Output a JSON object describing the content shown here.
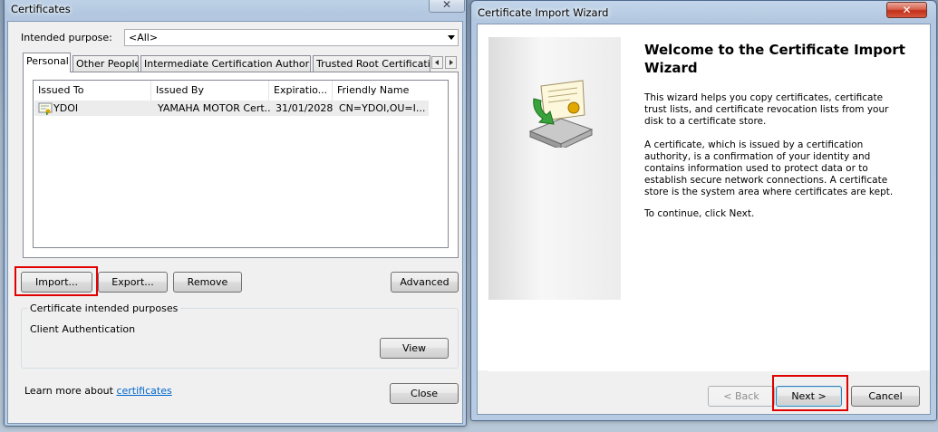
{
  "certificates": {
    "title": "Certificates",
    "intended_purpose_label": "Intended purpose:",
    "intended_purpose_value": "<All>",
    "tabs": [
      "Personal",
      "Other People",
      "Intermediate Certification Authorities",
      "Trusted Root Certification"
    ],
    "columns": [
      "Issued To",
      "Issued By",
      "Expiratio...",
      "Friendly Name"
    ],
    "rows": [
      {
        "issued_to": "YDOI",
        "issued_by": "YAMAHA MOTOR Cert...",
        "expiration": "31/01/2028",
        "friendly_name": "CN=YDOI,OU=I..."
      }
    ],
    "buttons": {
      "import": "Import...",
      "export": "Export...",
      "remove": "Remove",
      "advanced": "Advanced",
      "view": "View",
      "close": "Close"
    },
    "purposes_group_title": "Certificate intended purposes",
    "purposes_value": "Client Authentication",
    "learn_more_text": "Learn more about",
    "learn_more_link": "certificates",
    "close_glyph": "✕"
  },
  "wizard": {
    "title": "Certificate Import Wizard",
    "heading": "Welcome to the Certificate Import Wizard",
    "para1": "This wizard helps you copy certificates, certificate trust lists, and certificate revocation lists from your disk to a certificate store.",
    "para2": "A certificate, which is issued by a certification authority, is a confirmation of your identity and contains information used to protect data or to establish secure network connections. A certificate store is the system area where certificates are kept.",
    "para3": "To continue, click Next.",
    "buttons": {
      "back": "< Back",
      "next": "Next >",
      "cancel": "Cancel"
    },
    "close_glyph": "✕"
  },
  "colors": {
    "highlight": "#e10000",
    "link": "#0066cc",
    "close_red": "#c1301a"
  },
  "icons": [
    "certificate-icon",
    "certificate-import-icon",
    "close-icon",
    "chevron-down-icon",
    "chevron-left-icon",
    "chevron-right-icon"
  ]
}
